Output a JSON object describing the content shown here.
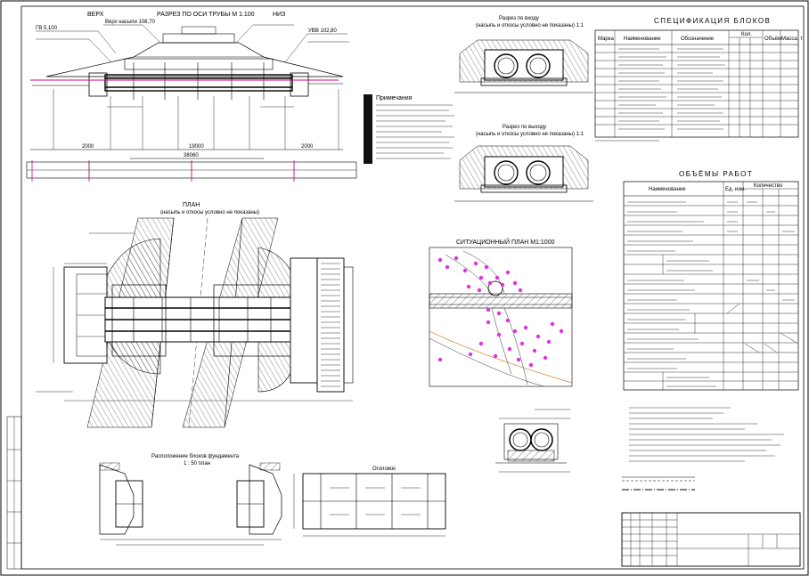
{
  "titles": {
    "profile_left": "ВЕРХ",
    "profile_center": "РАЗРЕЗ ПО ОСИ ТРУБЫ  М 1:100",
    "profile_right": "НИЗ",
    "plan": "ПЛАН",
    "plan_sub": "(насыпь и откосы условно не показаны)",
    "inlet_section": "Разрез по входу",
    "inlet_sub": "(насыпь и откосы условно не показаны) 1:1",
    "outlet_section": "Разрез по выходу",
    "outlet_sub": "(насыпь и откосы условно не показаны) 1:1",
    "situation_plan": "СИТУАЦИОННЫЙ ПЛАН М1:1000",
    "foundation_left": "Расположение блоков фундамента",
    "foundation_left_sub": "1 : 50 план",
    "foundation_right": "Оголовок",
    "spec_table": "СПЕЦИФИКАЦИЯ БЛОКОВ",
    "volume_table": "ОБЪЁМЫ РАБОТ"
  },
  "profile": {
    "marks_top": [
      "ГВ 5,100",
      "УВВ 102,80",
      "Верх насыпи 108,70"
    ],
    "total_length": "38060",
    "segments": [
      "2000",
      "19000",
      "2000"
    ]
  },
  "spec_table": {
    "headers": [
      "Марка",
      "Наименование",
      "Обозначение",
      "Кол.",
      "Объём",
      "Масса, т"
    ]
  },
  "volume_table": {
    "headers": [
      "Наименование",
      "Ед. изм.",
      "Количество"
    ]
  },
  "notes_title": "Примечания",
  "colors": {
    "line": "#000000",
    "accent_water": "#cc0088",
    "points": "#e033e0"
  }
}
